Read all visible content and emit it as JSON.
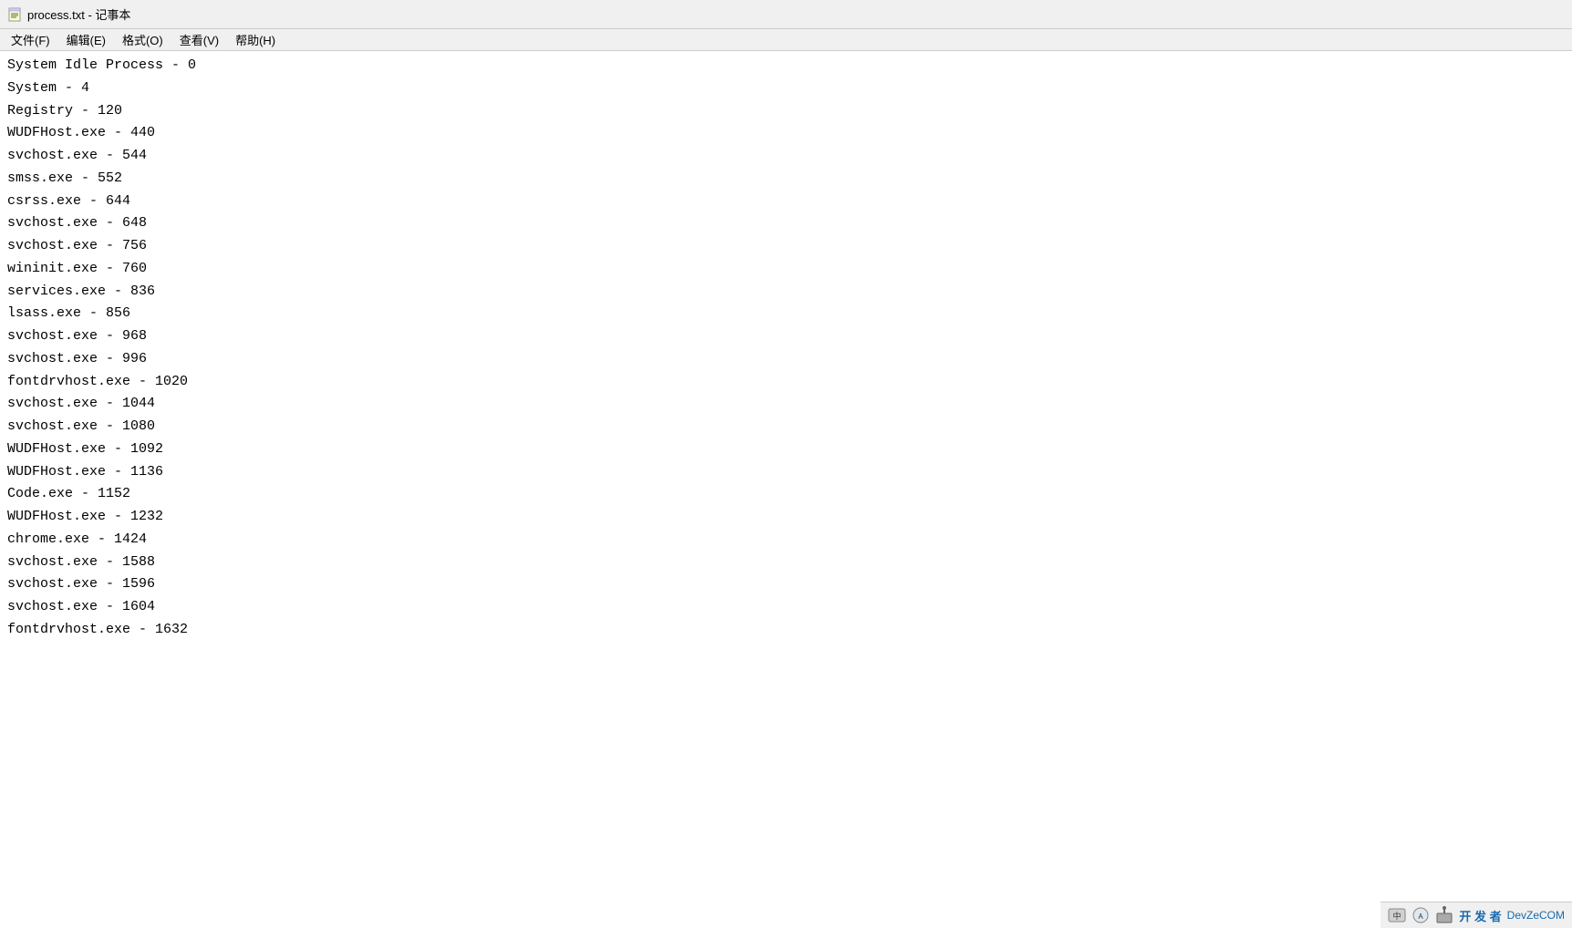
{
  "window": {
    "title": "process.txt - 记事本",
    "icon_label": "notepad-icon"
  },
  "menu": {
    "items": [
      {
        "label": "文件(F)"
      },
      {
        "label": "编辑(E)"
      },
      {
        "label": "格式(O)"
      },
      {
        "label": "查看(V)"
      },
      {
        "label": "帮助(H)"
      }
    ]
  },
  "processes": [
    "System Idle Process - 0",
    "System - 4",
    "Registry - 120",
    "WUDFHost.exe - 440",
    "svchost.exe - 544",
    "smss.exe - 552",
    "csrss.exe - 644",
    "svchost.exe - 648",
    "svchost.exe - 756",
    "wininit.exe - 760",
    "services.exe - 836",
    "lsass.exe - 856",
    "svchost.exe - 968",
    "svchost.exe - 996",
    "fontdrvhost.exe - 1020",
    "svchost.exe - 1044",
    "svchost.exe - 1080",
    "WUDFHost.exe - 1092",
    "WUDFHost.exe - 1136",
    "Code.exe - 1152",
    "WUDFHost.exe - 1232",
    "chrome.exe - 1424",
    "svchost.exe - 1588",
    "svchost.exe - 1596",
    "svchost.exe - 1604",
    "fontdrvhost.exe - 1632"
  ],
  "taskbar": {
    "label": "开 发 者",
    "sublabel": "DevZeCOM"
  }
}
